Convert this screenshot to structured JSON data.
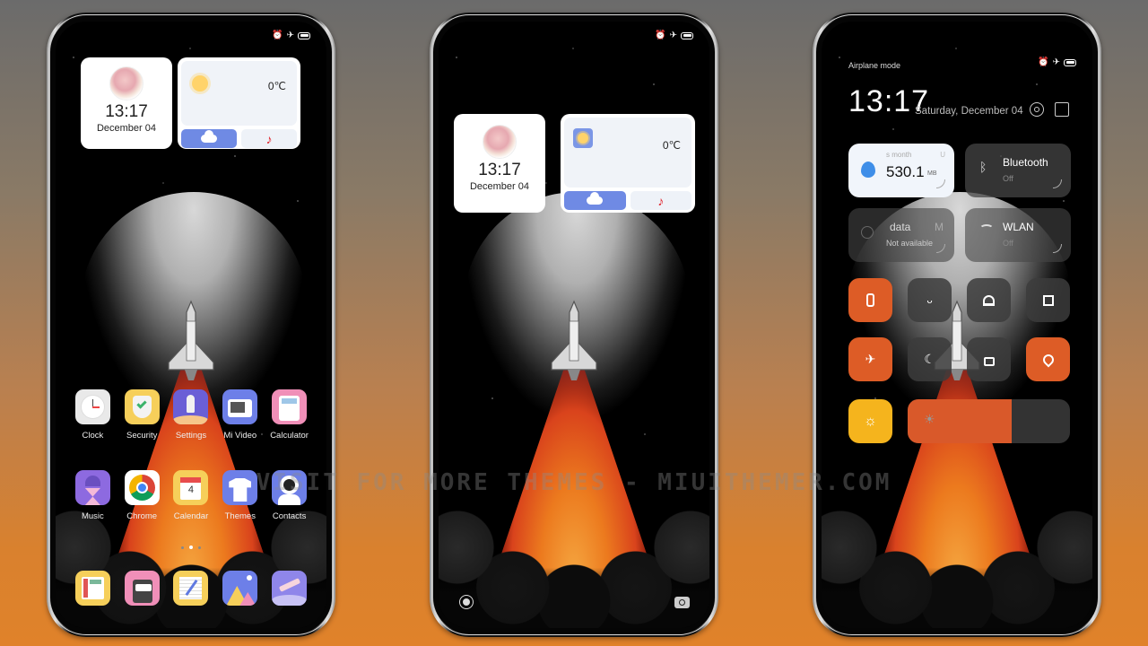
{
  "watermark": "VISIT FOR MORE THEMES - MIUITHEMER.COM",
  "status_icons": [
    "alarm-icon",
    "airplane-icon",
    "battery-icon"
  ],
  "phone1": {
    "clock_widget": {
      "time": "13:17",
      "date": "December 04"
    },
    "weather_widget": {
      "temperature": "0℃",
      "buttons": [
        "weather-cloud",
        "music-note"
      ]
    },
    "apps_row1": [
      {
        "label": "Clock",
        "icon": "clock-icon",
        "color": "#e9e9e9"
      },
      {
        "label": "Security",
        "icon": "shield-check-icon",
        "color": "#f6cf5a"
      },
      {
        "label": "Settings",
        "icon": "rocket-icon",
        "color": "#6a5fd6"
      },
      {
        "label": "Mi Video",
        "icon": "tv-icon",
        "color": "#6d7fe8"
      },
      {
        "label": "Calculator",
        "icon": "calculator-icon",
        "color": "#f08fb8"
      }
    ],
    "apps_row2": [
      {
        "label": "Music",
        "icon": "music-hourglass-icon",
        "color": "#8d6ae0"
      },
      {
        "label": "Chrome",
        "icon": "chrome-icon",
        "color": "#ffffff"
      },
      {
        "label": "Calendar",
        "icon": "calendar-icon",
        "color": "#f6cf5a",
        "day": "4"
      },
      {
        "label": "Themes",
        "icon": "tshirt-icon",
        "color": "#6d7fe8"
      },
      {
        "label": "Contacts",
        "icon": "astronaut-icon",
        "color": "#6d7fe8"
      }
    ],
    "page_dots": {
      "count": 3,
      "active": 1
    },
    "dock": [
      {
        "icon": "phone-icon",
        "color": "#f6cf5a"
      },
      {
        "icon": "messaging-icon",
        "color": "#f08fb8"
      },
      {
        "icon": "notes-icon",
        "color": "#f6cf5a"
      },
      {
        "icon": "gallery-icon",
        "color": "#6d7fe8"
      },
      {
        "icon": "telescope-icon",
        "color": "#8f86ea"
      }
    ]
  },
  "phone2": {
    "clock_widget": {
      "time": "13:17",
      "date": "December 04"
    },
    "weather_widget": {
      "temperature": "0℃"
    },
    "lock_shortcuts": [
      "assistant-icon",
      "camera-icon"
    ]
  },
  "phone3": {
    "status_label": "Airplane mode",
    "time": "13:17",
    "date": "Saturday, December 04",
    "header_icons": [
      "settings-ring-icon",
      "edit-icon"
    ],
    "data_usage": {
      "label": "s month",
      "label_trail": "U",
      "value": "530.1",
      "unit": "MB"
    },
    "bluetooth": {
      "title": "Bluetooth",
      "status": "Off"
    },
    "mobile_data": {
      "title": "data",
      "title_trail": "M",
      "status": "Not available"
    },
    "wlan": {
      "title": "WLAN",
      "status": "Off"
    },
    "toggles_row1": [
      {
        "icon": "vibrate-icon",
        "state": "on"
      },
      {
        "icon": "torch-icon",
        "state": "off"
      },
      {
        "icon": "bell-icon",
        "state": "off"
      },
      {
        "icon": "screenshot-crop-icon",
        "state": "off"
      }
    ],
    "toggles_row2": [
      {
        "icon": "airplane-icon",
        "state": "on"
      },
      {
        "icon": "dark-mode-icon",
        "state": "off"
      },
      {
        "icon": "rotation-lock-icon",
        "state": "off"
      },
      {
        "icon": "location-icon",
        "state": "on"
      }
    ],
    "auto_brightness": {
      "icon": "sun-icon",
      "state": "on"
    },
    "brightness_percent": 64
  }
}
